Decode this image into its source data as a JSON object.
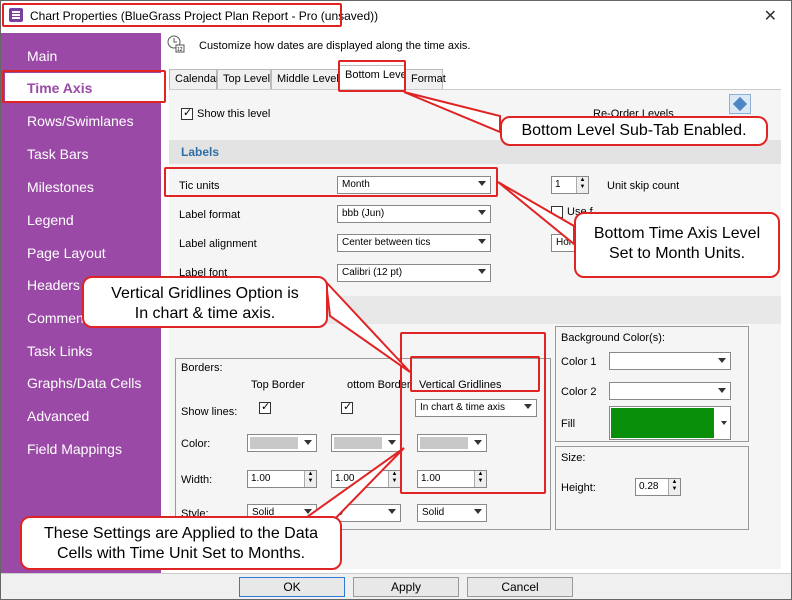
{
  "window": {
    "title": "Chart Properties (BlueGrass Project Plan Report - Pro (unsaved))"
  },
  "sidebar": {
    "items": [
      {
        "label": "Main"
      },
      {
        "label": "Time Axis"
      },
      {
        "label": "Rows/Swimlanes"
      },
      {
        "label": "Task Bars"
      },
      {
        "label": "Milestones"
      },
      {
        "label": "Legend"
      },
      {
        "label": "Page Layout"
      },
      {
        "label": "Headers"
      },
      {
        "label": "Commen"
      },
      {
        "label": "Task Links"
      },
      {
        "label": "Graphs/Data Cells"
      },
      {
        "label": "Advanced"
      },
      {
        "label": "Field Mappings"
      }
    ],
    "active": "Time Axis"
  },
  "header": {
    "description": "Customize how dates are displayed along the time axis."
  },
  "tabs": [
    {
      "label": "Calendar"
    },
    {
      "label": "Top Level"
    },
    {
      "label": "Middle Level"
    },
    {
      "label": "Bottom Level"
    },
    {
      "label": "Format"
    }
  ],
  "level": {
    "show_label": "Show this level",
    "reorder_label": "Re-Order Levels"
  },
  "labels_section": {
    "title": "Labels",
    "tic_units_label": "Tic units",
    "tic_units_value": "Month",
    "label_format_label": "Label format",
    "label_format_value": "bbb (Jun)",
    "label_alignment_label": "Label alignment",
    "label_alignment_value": "Center between tics",
    "label_font_label": "Label font",
    "label_font_value": "Calibri (12 pt)",
    "unit_skip_value": "1",
    "unit_skip_label": "Unit skip count",
    "use_fiscal_label": "Use f",
    "hor_value": "Hor"
  },
  "borders": {
    "title": "Borders:",
    "top_border": "Top Border",
    "bottom_border": "ottom Border",
    "vertical_gridlines": "Vertical Gridlines",
    "show_lines": "Show lines:",
    "vgrid_value": "In chart & time axis",
    "color": "Color:",
    "width": "Width:",
    "style": "Style:",
    "top_width": "1.00",
    "bottom_width": "1.00",
    "vgrid_width": "1.00",
    "top_style": "Solid",
    "bottom_style": "D",
    "vgrid_style": "Solid"
  },
  "background": {
    "title": "Background Color(s):",
    "color1": "Color 1",
    "color2": "Color 2",
    "fill": "Fill",
    "fill_color": "#0a8f0a"
  },
  "size": {
    "title": "Size:",
    "height_label": "Height:",
    "height_value": "0.28"
  },
  "footer": {
    "ok": "OK",
    "apply": "Apply",
    "cancel": "Cancel"
  },
  "annotations": {
    "bottom_level": "Bottom Level Sub-Tab Enabled.",
    "month_units": "Bottom Time Axis Level Set to Month Units.",
    "gridlines": "Vertical Gridlines Option is In chart & time axis.",
    "data_cells": "These Settings are Applied to the Data Cells with Time Unit Set to Months."
  },
  "colors": {
    "sidebar": "#9a4aa6",
    "callout_border": "#e02424",
    "section_text": "#2f6ea5"
  }
}
